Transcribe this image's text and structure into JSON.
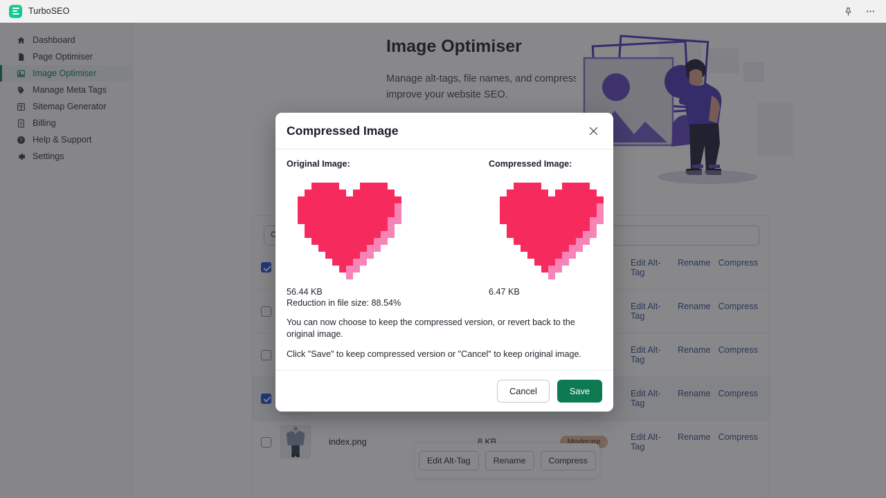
{
  "topbar": {
    "app_name": "TurboSEO",
    "logo_icon": "turboseo-logo-icon",
    "pin_icon": "pin-icon",
    "more_icon": "more-options-icon"
  },
  "sidebar": {
    "items": [
      {
        "label": "Dashboard",
        "icon": "home-icon",
        "active": false
      },
      {
        "label": "Page Optimiser",
        "icon": "page-icon",
        "active": false
      },
      {
        "label": "Image Optimiser",
        "icon": "image-icon",
        "active": true
      },
      {
        "label": "Manage Meta Tags",
        "icon": "tag-icon",
        "active": false
      },
      {
        "label": "Sitemap Generator",
        "icon": "sitemap-icon",
        "active": false
      },
      {
        "label": "Billing",
        "icon": "billing-icon",
        "active": false
      },
      {
        "label": "Help & Support",
        "icon": "help-icon",
        "active": false
      },
      {
        "label": "Settings",
        "icon": "gear-icon",
        "active": false
      }
    ],
    "active_color": "#0d7a59"
  },
  "page": {
    "title": "Image Optimiser",
    "subtitle": "Manage alt-tags, file names, and compress images to improve your website SEO.",
    "hero_illustration": "person-with-image-frames-illustration"
  },
  "search": {
    "value": "",
    "placeholder": "",
    "icon": "search-icon"
  },
  "table": {
    "rows": [
      {
        "checked": true,
        "name": "",
        "size": "",
        "badge": "",
        "thumb": ""
      },
      {
        "checked": false,
        "name": "",
        "size": "",
        "badge": "",
        "thumb": ""
      },
      {
        "checked": false,
        "name": "",
        "size": "",
        "badge": "",
        "thumb": ""
      },
      {
        "checked": true,
        "name": "",
        "size": "",
        "badge": "",
        "thumb": ""
      },
      {
        "checked": false,
        "name": "index.png",
        "size": "8 KB",
        "badge": "Moderate",
        "thumb": "shirt-thumbnail"
      }
    ],
    "actions": [
      "Edit Alt-Tag",
      "Rename",
      "Compress"
    ],
    "badge_color": "#e0b394",
    "link_color": "#2a4a86"
  },
  "bulk_bar": {
    "buttons": [
      "Edit Alt-Tag",
      "Rename",
      "Compress"
    ]
  },
  "modal": {
    "title": "Compressed Image",
    "close_icon": "close-icon",
    "original": {
      "label": "Original Image:",
      "size": "56.44 KB",
      "image": "pixel-heart-image"
    },
    "compressed": {
      "label": "Compressed Image:",
      "size": "6.47 KB",
      "image": "pixel-heart-image"
    },
    "reduction": "Reduction in file size: 88.54%",
    "paragraph_1": "You can now choose to keep the compressed version, or revert back to the original image.",
    "paragraph_2": "Click \"Save\" to keep compressed version or \"Cancel\" to keep original image.",
    "cancel_label": "Cancel",
    "save_label": "Save",
    "save_color": "#0d7a52",
    "heart_color": "#f72a5e",
    "heart_shadow_color": "#f784b7"
  }
}
